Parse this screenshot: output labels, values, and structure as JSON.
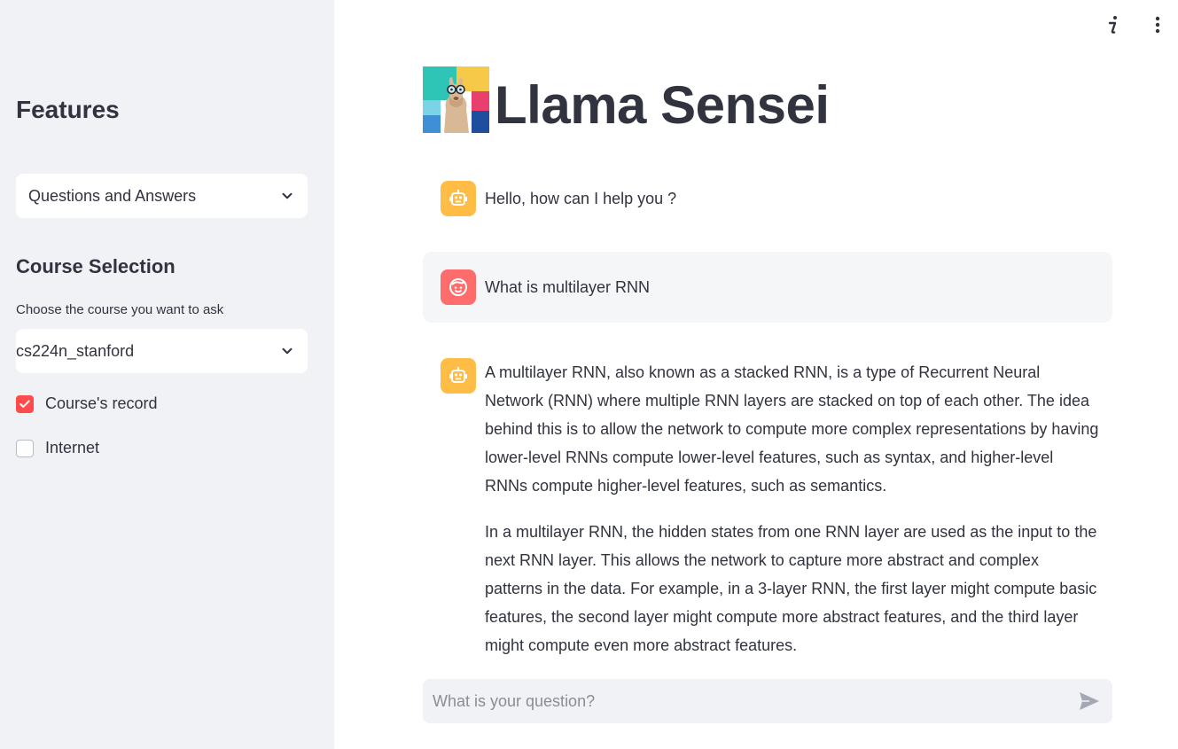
{
  "sidebar": {
    "features_heading": "Features",
    "features_select_value": "Questions and Answers",
    "course_heading": "Course Selection",
    "course_caption": "Choose the course you want to ask",
    "course_select_value": "cs224n_stanford",
    "checkboxes": [
      {
        "label": "Course's record",
        "checked": true
      },
      {
        "label": "Internet",
        "checked": false
      }
    ]
  },
  "header": {
    "title": "Llama Sensei",
    "icons": [
      "info-icon",
      "more-vert-icon"
    ]
  },
  "chat": {
    "messages": [
      {
        "role": "assistant",
        "avatar": "robot-icon",
        "text": "Hello, how can I help you ?"
      },
      {
        "role": "user",
        "avatar": "smiley-icon",
        "text": "What is multilayer RNN"
      },
      {
        "role": "assistant",
        "avatar": "robot-icon",
        "paragraphs": [
          "A multilayer RNN, also known as a stacked RNN, is a type of Recurrent Neural Network (RNN) where multiple RNN layers are stacked on top of each other. The idea behind this is to allow the network to compute more complex representations by having lower-level RNNs compute lower-level features, such as syntax, and higher-level RNNs compute higher-level features, such as semantics.",
          "In a multilayer RNN, the hidden states from one RNN layer are used as the input to the next RNN layer. This allows the network to capture more abstract and complex patterns in the data. For example, in a 3-layer RNN, the first layer might compute basic features, the second layer might compute more abstract features, and the third layer might compute even more abstract features."
        ]
      }
    ],
    "input_placeholder": "What is your question?"
  },
  "colors": {
    "accent": "#ff4b4b",
    "sidebar_bg": "#f0f2f6",
    "bot_avatar": "#ffbd45",
    "user_avatar": "#ff6c6c",
    "text": "#31333f"
  }
}
